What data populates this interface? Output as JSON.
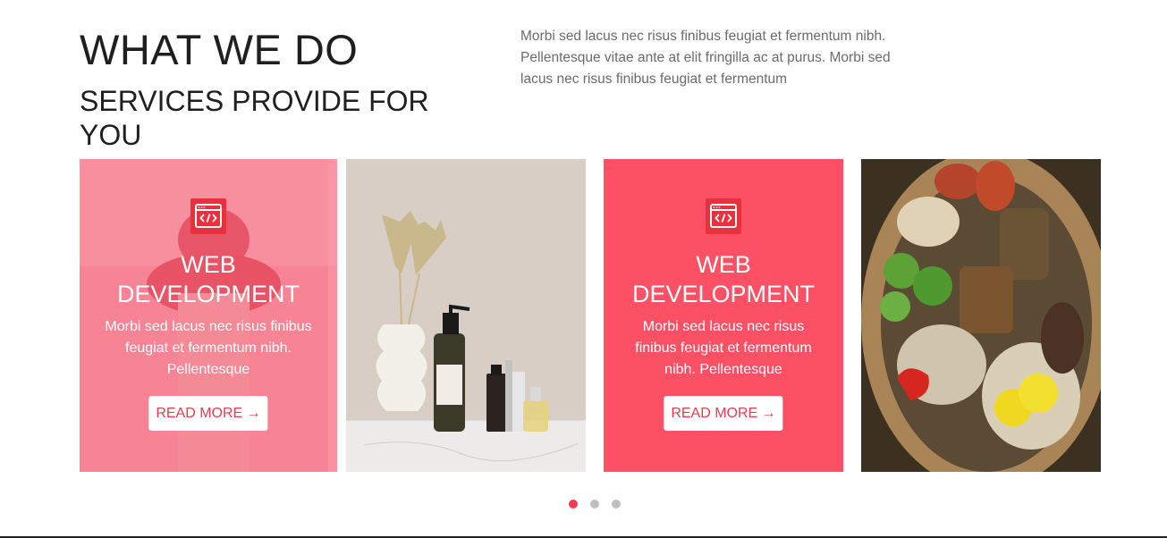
{
  "header": {
    "title": "WHAT WE DO",
    "subtitle": "SERVICES PROVIDE FOR YOU",
    "intro": "Morbi sed lacus nec risus finibus feugiat et fermentum nibh. Pellentesque vitae ante at elit fringilla ac at purus. Morbi sed lacus nec risus finibus feugiat et fermentum"
  },
  "slides": [
    {
      "type": "service",
      "icon": "code-window-icon",
      "title": "WEB DEVELOPMENT",
      "text": "Morbi sed lacus nec risus finibus feugiat et fermentum nibh. Pellentesque",
      "button": "READ MORE →",
      "overlay_color": "#f58292"
    },
    {
      "type": "photo",
      "subject": "vase and cosmetic bottles"
    },
    {
      "type": "service",
      "icon": "code-window-icon",
      "title": "WEB DEVELOPMENT",
      "text": "Morbi sed lacus nec risus finibus feugiat et fermentum nibh. Pellentesque",
      "button": "READ MORE →",
      "overlay_color": "#fc5065"
    },
    {
      "type": "photo",
      "subject": "basket of groceries"
    }
  ],
  "pagination": {
    "count": 3,
    "active": 1
  },
  "colors": {
    "accent": "#fc5065",
    "button_text": "#e63c50",
    "dot_inactive": "#c0c0c0"
  }
}
